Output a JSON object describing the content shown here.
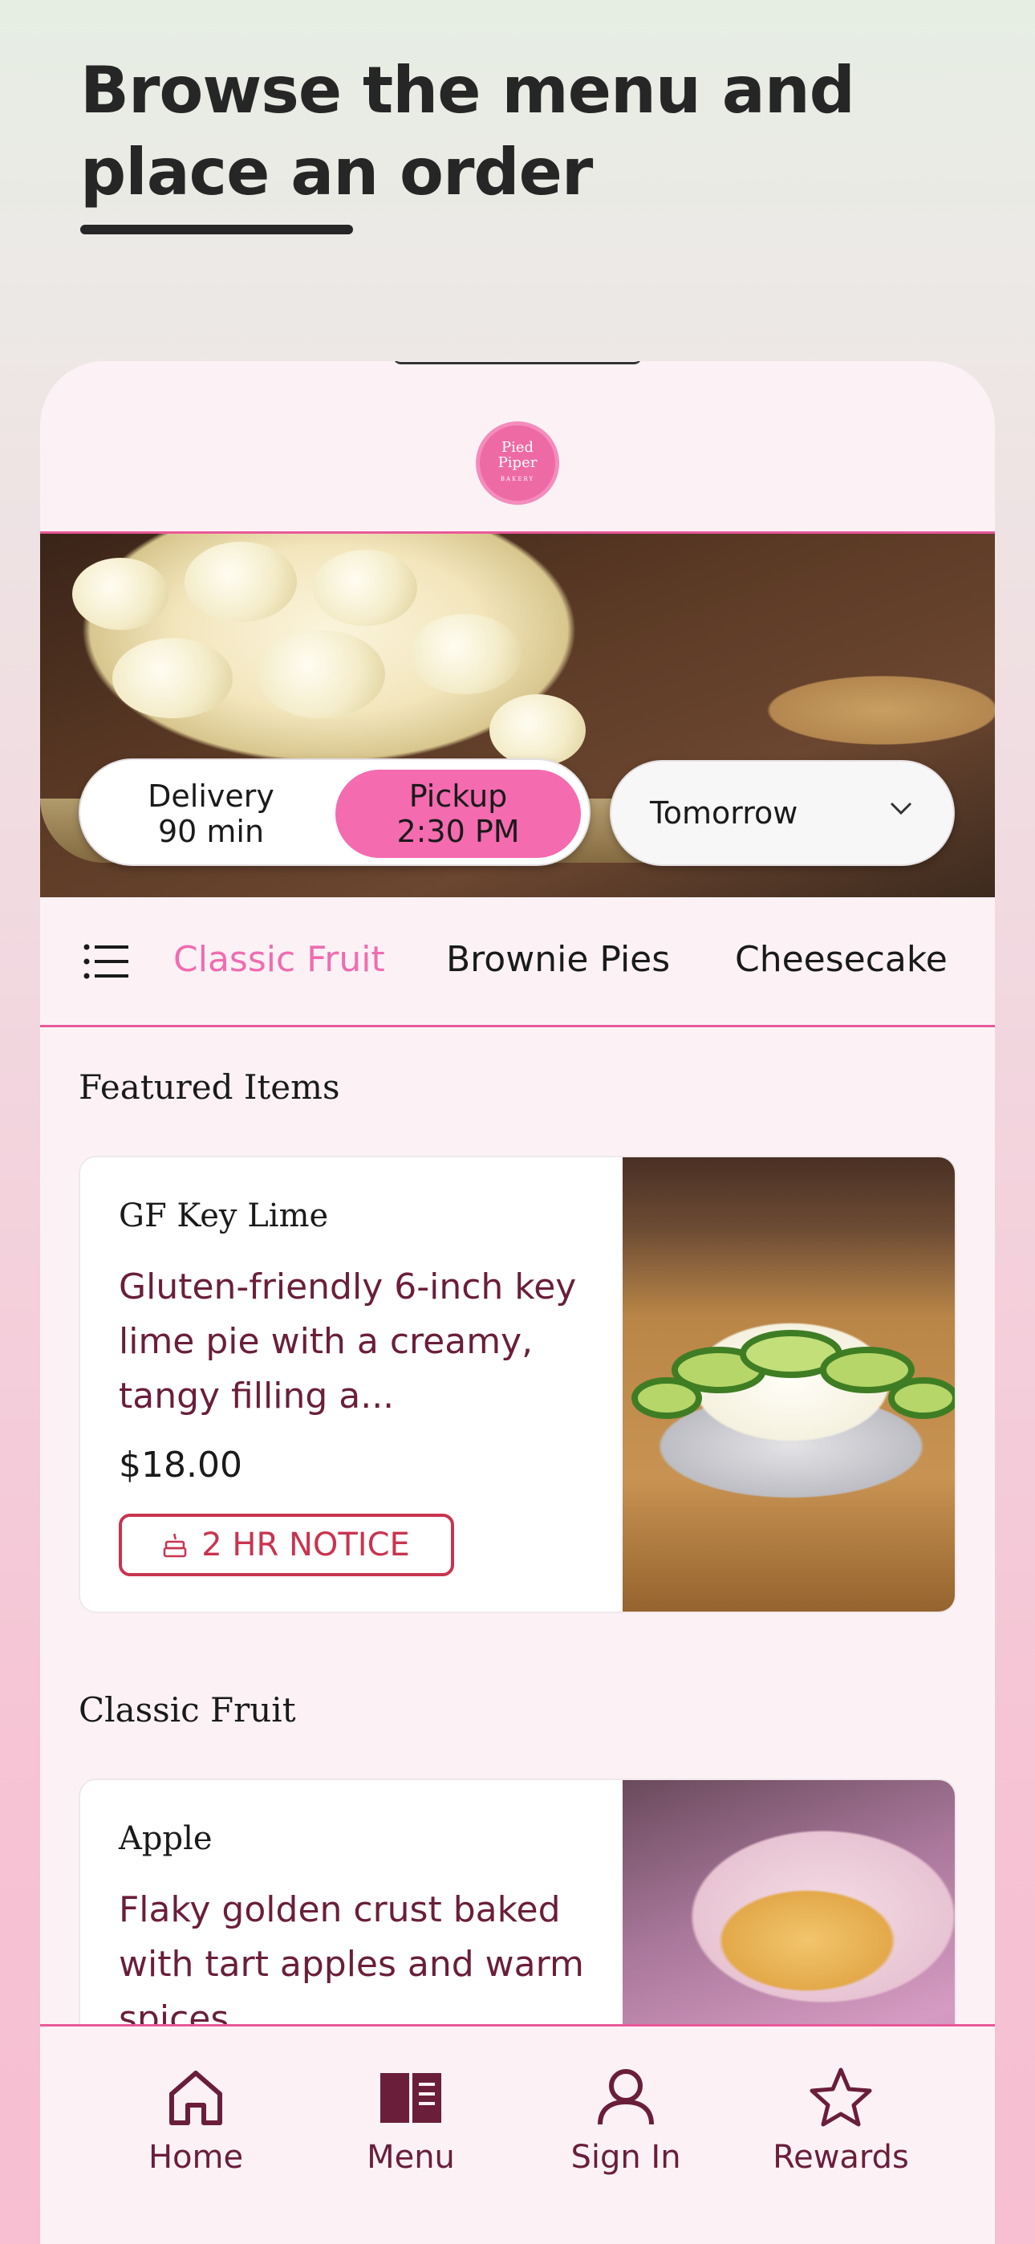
{
  "headline": {
    "line1": "Browse the menu and",
    "line2": "place an order"
  },
  "logo": {
    "line1": "Pied",
    "line2": "Piper",
    "line3": "BAKERY"
  },
  "order_mode": {
    "delivery_label": "Delivery",
    "delivery_time": "90 min",
    "pickup_label": "Pickup",
    "pickup_time": "2:30 PM",
    "selected": "pickup"
  },
  "day_select": {
    "value": "Tomorrow",
    "icon": "chevron-down-icon"
  },
  "categories": {
    "icon": "list-menu-icon",
    "items": [
      "Classic Fruit",
      "Brownie Pies",
      "Cheesecake"
    ],
    "active": "Classic Fruit"
  },
  "featured": {
    "title": "Featured Items",
    "item": {
      "name": "GF Key Lime",
      "description": "Gluten-friendly 6-inch key lime pie with a creamy, tangy filling a...",
      "price": "$18.00",
      "badge": "2 HR NOTICE",
      "badge_icon": "cake-icon"
    }
  },
  "classic_fruit": {
    "title": "Classic Fruit",
    "item": {
      "name": "Apple",
      "description": "Flaky golden crust baked with tart apples and warm spices."
    }
  },
  "bottom_nav": {
    "items": [
      {
        "label": "Home",
        "icon": "home-icon"
      },
      {
        "label": "Menu",
        "icon": "menu-book-icon"
      },
      {
        "label": "Sign In",
        "icon": "person-icon"
      },
      {
        "label": "Rewards",
        "icon": "star-icon"
      }
    ],
    "active": "Menu"
  },
  "colors": {
    "accent_pink": "#f06cb0",
    "brand_maroon": "#6a1e3a",
    "badge_red": "#c8344f"
  }
}
